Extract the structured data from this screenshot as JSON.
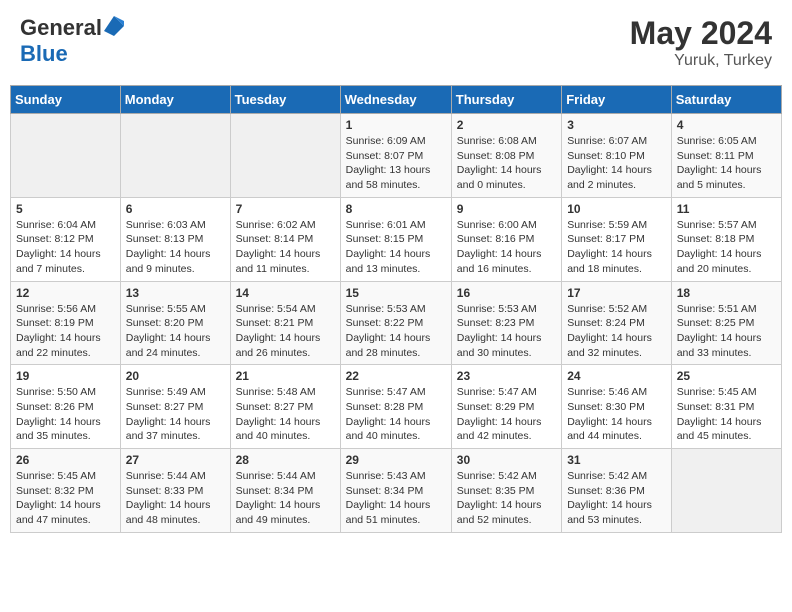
{
  "header": {
    "logo_general": "General",
    "logo_blue": "Blue",
    "month_year": "May 2024",
    "location": "Yuruk, Turkey"
  },
  "days_of_week": [
    "Sunday",
    "Monday",
    "Tuesday",
    "Wednesday",
    "Thursday",
    "Friday",
    "Saturday"
  ],
  "weeks": [
    [
      {
        "day": "",
        "sunrise": "",
        "sunset": "",
        "daylight": "",
        "empty": true
      },
      {
        "day": "",
        "sunrise": "",
        "sunset": "",
        "daylight": "",
        "empty": true
      },
      {
        "day": "",
        "sunrise": "",
        "sunset": "",
        "daylight": "",
        "empty": true
      },
      {
        "day": "1",
        "sunrise": "Sunrise: 6:09 AM",
        "sunset": "Sunset: 8:07 PM",
        "daylight": "Daylight: 13 hours and 58 minutes."
      },
      {
        "day": "2",
        "sunrise": "Sunrise: 6:08 AM",
        "sunset": "Sunset: 8:08 PM",
        "daylight": "Daylight: 14 hours and 0 minutes."
      },
      {
        "day": "3",
        "sunrise": "Sunrise: 6:07 AM",
        "sunset": "Sunset: 8:10 PM",
        "daylight": "Daylight: 14 hours and 2 minutes."
      },
      {
        "day": "4",
        "sunrise": "Sunrise: 6:05 AM",
        "sunset": "Sunset: 8:11 PM",
        "daylight": "Daylight: 14 hours and 5 minutes."
      }
    ],
    [
      {
        "day": "5",
        "sunrise": "Sunrise: 6:04 AM",
        "sunset": "Sunset: 8:12 PM",
        "daylight": "Daylight: 14 hours and 7 minutes."
      },
      {
        "day": "6",
        "sunrise": "Sunrise: 6:03 AM",
        "sunset": "Sunset: 8:13 PM",
        "daylight": "Daylight: 14 hours and 9 minutes."
      },
      {
        "day": "7",
        "sunrise": "Sunrise: 6:02 AM",
        "sunset": "Sunset: 8:14 PM",
        "daylight": "Daylight: 14 hours and 11 minutes."
      },
      {
        "day": "8",
        "sunrise": "Sunrise: 6:01 AM",
        "sunset": "Sunset: 8:15 PM",
        "daylight": "Daylight: 14 hours and 13 minutes."
      },
      {
        "day": "9",
        "sunrise": "Sunrise: 6:00 AM",
        "sunset": "Sunset: 8:16 PM",
        "daylight": "Daylight: 14 hours and 16 minutes."
      },
      {
        "day": "10",
        "sunrise": "Sunrise: 5:59 AM",
        "sunset": "Sunset: 8:17 PM",
        "daylight": "Daylight: 14 hours and 18 minutes."
      },
      {
        "day": "11",
        "sunrise": "Sunrise: 5:57 AM",
        "sunset": "Sunset: 8:18 PM",
        "daylight": "Daylight: 14 hours and 20 minutes."
      }
    ],
    [
      {
        "day": "12",
        "sunrise": "Sunrise: 5:56 AM",
        "sunset": "Sunset: 8:19 PM",
        "daylight": "Daylight: 14 hours and 22 minutes."
      },
      {
        "day": "13",
        "sunrise": "Sunrise: 5:55 AM",
        "sunset": "Sunset: 8:20 PM",
        "daylight": "Daylight: 14 hours and 24 minutes."
      },
      {
        "day": "14",
        "sunrise": "Sunrise: 5:54 AM",
        "sunset": "Sunset: 8:21 PM",
        "daylight": "Daylight: 14 hours and 26 minutes."
      },
      {
        "day": "15",
        "sunrise": "Sunrise: 5:53 AM",
        "sunset": "Sunset: 8:22 PM",
        "daylight": "Daylight: 14 hours and 28 minutes."
      },
      {
        "day": "16",
        "sunrise": "Sunrise: 5:53 AM",
        "sunset": "Sunset: 8:23 PM",
        "daylight": "Daylight: 14 hours and 30 minutes."
      },
      {
        "day": "17",
        "sunrise": "Sunrise: 5:52 AM",
        "sunset": "Sunset: 8:24 PM",
        "daylight": "Daylight: 14 hours and 32 minutes."
      },
      {
        "day": "18",
        "sunrise": "Sunrise: 5:51 AM",
        "sunset": "Sunset: 8:25 PM",
        "daylight": "Daylight: 14 hours and 33 minutes."
      }
    ],
    [
      {
        "day": "19",
        "sunrise": "Sunrise: 5:50 AM",
        "sunset": "Sunset: 8:26 PM",
        "daylight": "Daylight: 14 hours and 35 minutes."
      },
      {
        "day": "20",
        "sunrise": "Sunrise: 5:49 AM",
        "sunset": "Sunset: 8:27 PM",
        "daylight": "Daylight: 14 hours and 37 minutes."
      },
      {
        "day": "21",
        "sunrise": "Sunrise: 5:48 AM",
        "sunset": "Sunset: 8:27 PM",
        "daylight": "Daylight: 14 hours and 40 minutes."
      },
      {
        "day": "22",
        "sunrise": "Sunrise: 5:47 AM",
        "sunset": "Sunset: 8:28 PM",
        "daylight": "Daylight: 14 hours and 40 minutes."
      },
      {
        "day": "23",
        "sunrise": "Sunrise: 5:47 AM",
        "sunset": "Sunset: 8:29 PM",
        "daylight": "Daylight: 14 hours and 42 minutes."
      },
      {
        "day": "24",
        "sunrise": "Sunrise: 5:46 AM",
        "sunset": "Sunset: 8:30 PM",
        "daylight": "Daylight: 14 hours and 44 minutes."
      },
      {
        "day": "25",
        "sunrise": "Sunrise: 5:45 AM",
        "sunset": "Sunset: 8:31 PM",
        "daylight": "Daylight: 14 hours and 45 minutes."
      }
    ],
    [
      {
        "day": "26",
        "sunrise": "Sunrise: 5:45 AM",
        "sunset": "Sunset: 8:32 PM",
        "daylight": "Daylight: 14 hours and 47 minutes."
      },
      {
        "day": "27",
        "sunrise": "Sunrise: 5:44 AM",
        "sunset": "Sunset: 8:33 PM",
        "daylight": "Daylight: 14 hours and 48 minutes."
      },
      {
        "day": "28",
        "sunrise": "Sunrise: 5:44 AM",
        "sunset": "Sunset: 8:34 PM",
        "daylight": "Daylight: 14 hours and 49 minutes."
      },
      {
        "day": "29",
        "sunrise": "Sunrise: 5:43 AM",
        "sunset": "Sunset: 8:34 PM",
        "daylight": "Daylight: 14 hours and 51 minutes."
      },
      {
        "day": "30",
        "sunrise": "Sunrise: 5:42 AM",
        "sunset": "Sunset: 8:35 PM",
        "daylight": "Daylight: 14 hours and 52 minutes."
      },
      {
        "day": "31",
        "sunrise": "Sunrise: 5:42 AM",
        "sunset": "Sunset: 8:36 PM",
        "daylight": "Daylight: 14 hours and 53 minutes."
      },
      {
        "day": "",
        "sunrise": "",
        "sunset": "",
        "daylight": "",
        "empty": true
      }
    ]
  ]
}
